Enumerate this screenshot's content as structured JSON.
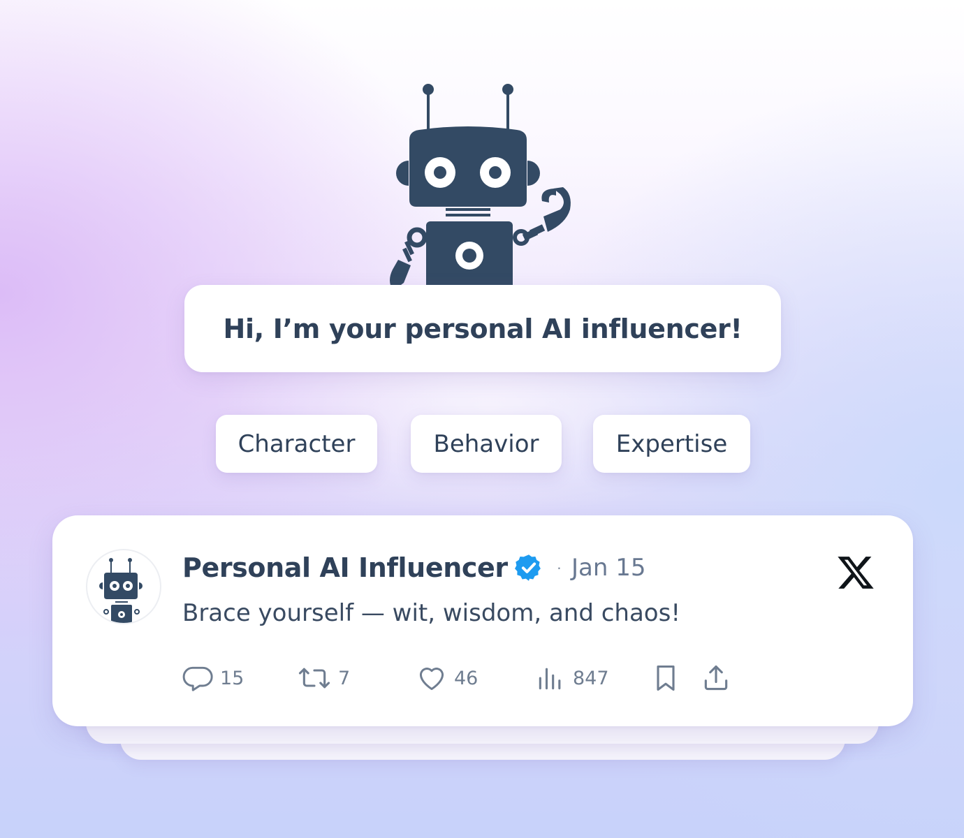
{
  "greeting": {
    "text": "Hi, I’m your personal AI influencer!"
  },
  "chips": [
    {
      "label": "Character"
    },
    {
      "label": "Behavior"
    },
    {
      "label": "Expertise"
    }
  ],
  "post": {
    "author_name": "Personal AI Influencer",
    "separator": "·",
    "date": "Jan 15",
    "body": "Brace yourself — wit, wisdom, and chaos!",
    "platform_icon": "x-logo-icon",
    "verified_icon": "verified-badge-icon",
    "actions": {
      "replies": "15",
      "reposts": "7",
      "likes": "46",
      "views": "847"
    }
  },
  "colors": {
    "text_dark": "#2f4159",
    "robot": "#334a64",
    "verified_blue": "#1d9bf0",
    "muted": "#6f7d90"
  }
}
